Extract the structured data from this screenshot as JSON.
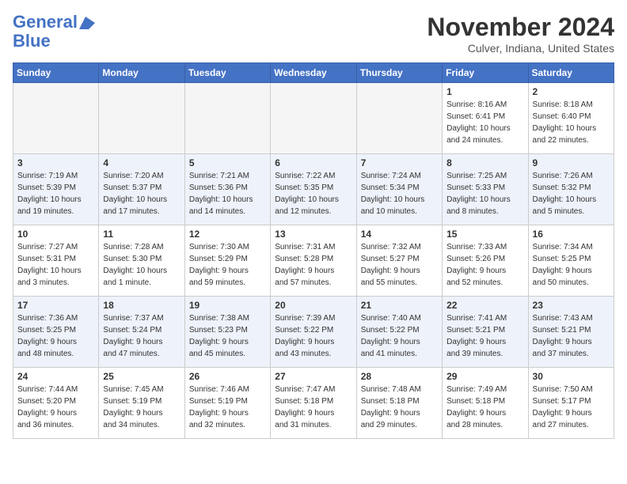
{
  "logo": {
    "line1": "General",
    "line2": "Blue"
  },
  "header": {
    "month": "November 2024",
    "location": "Culver, Indiana, United States"
  },
  "weekdays": [
    "Sunday",
    "Monday",
    "Tuesday",
    "Wednesday",
    "Thursday",
    "Friday",
    "Saturday"
  ],
  "weeks": [
    [
      {
        "day": "",
        "info": ""
      },
      {
        "day": "",
        "info": ""
      },
      {
        "day": "",
        "info": ""
      },
      {
        "day": "",
        "info": ""
      },
      {
        "day": "",
        "info": ""
      },
      {
        "day": "1",
        "info": "Sunrise: 8:16 AM\nSunset: 6:41 PM\nDaylight: 10 hours\nand 24 minutes."
      },
      {
        "day": "2",
        "info": "Sunrise: 8:18 AM\nSunset: 6:40 PM\nDaylight: 10 hours\nand 22 minutes."
      }
    ],
    [
      {
        "day": "3",
        "info": "Sunrise: 7:19 AM\nSunset: 5:39 PM\nDaylight: 10 hours\nand 19 minutes."
      },
      {
        "day": "4",
        "info": "Sunrise: 7:20 AM\nSunset: 5:37 PM\nDaylight: 10 hours\nand 17 minutes."
      },
      {
        "day": "5",
        "info": "Sunrise: 7:21 AM\nSunset: 5:36 PM\nDaylight: 10 hours\nand 14 minutes."
      },
      {
        "day": "6",
        "info": "Sunrise: 7:22 AM\nSunset: 5:35 PM\nDaylight: 10 hours\nand 12 minutes."
      },
      {
        "day": "7",
        "info": "Sunrise: 7:24 AM\nSunset: 5:34 PM\nDaylight: 10 hours\nand 10 minutes."
      },
      {
        "day": "8",
        "info": "Sunrise: 7:25 AM\nSunset: 5:33 PM\nDaylight: 10 hours\nand 8 minutes."
      },
      {
        "day": "9",
        "info": "Sunrise: 7:26 AM\nSunset: 5:32 PM\nDaylight: 10 hours\nand 5 minutes."
      }
    ],
    [
      {
        "day": "10",
        "info": "Sunrise: 7:27 AM\nSunset: 5:31 PM\nDaylight: 10 hours\nand 3 minutes."
      },
      {
        "day": "11",
        "info": "Sunrise: 7:28 AM\nSunset: 5:30 PM\nDaylight: 10 hours\nand 1 minute."
      },
      {
        "day": "12",
        "info": "Sunrise: 7:30 AM\nSunset: 5:29 PM\nDaylight: 9 hours\nand 59 minutes."
      },
      {
        "day": "13",
        "info": "Sunrise: 7:31 AM\nSunset: 5:28 PM\nDaylight: 9 hours\nand 57 minutes."
      },
      {
        "day": "14",
        "info": "Sunrise: 7:32 AM\nSunset: 5:27 PM\nDaylight: 9 hours\nand 55 minutes."
      },
      {
        "day": "15",
        "info": "Sunrise: 7:33 AM\nSunset: 5:26 PM\nDaylight: 9 hours\nand 52 minutes."
      },
      {
        "day": "16",
        "info": "Sunrise: 7:34 AM\nSunset: 5:25 PM\nDaylight: 9 hours\nand 50 minutes."
      }
    ],
    [
      {
        "day": "17",
        "info": "Sunrise: 7:36 AM\nSunset: 5:25 PM\nDaylight: 9 hours\nand 48 minutes."
      },
      {
        "day": "18",
        "info": "Sunrise: 7:37 AM\nSunset: 5:24 PM\nDaylight: 9 hours\nand 47 minutes."
      },
      {
        "day": "19",
        "info": "Sunrise: 7:38 AM\nSunset: 5:23 PM\nDaylight: 9 hours\nand 45 minutes."
      },
      {
        "day": "20",
        "info": "Sunrise: 7:39 AM\nSunset: 5:22 PM\nDaylight: 9 hours\nand 43 minutes."
      },
      {
        "day": "21",
        "info": "Sunrise: 7:40 AM\nSunset: 5:22 PM\nDaylight: 9 hours\nand 41 minutes."
      },
      {
        "day": "22",
        "info": "Sunrise: 7:41 AM\nSunset: 5:21 PM\nDaylight: 9 hours\nand 39 minutes."
      },
      {
        "day": "23",
        "info": "Sunrise: 7:43 AM\nSunset: 5:21 PM\nDaylight: 9 hours\nand 37 minutes."
      }
    ],
    [
      {
        "day": "24",
        "info": "Sunrise: 7:44 AM\nSunset: 5:20 PM\nDaylight: 9 hours\nand 36 minutes."
      },
      {
        "day": "25",
        "info": "Sunrise: 7:45 AM\nSunset: 5:19 PM\nDaylight: 9 hours\nand 34 minutes."
      },
      {
        "day": "26",
        "info": "Sunrise: 7:46 AM\nSunset: 5:19 PM\nDaylight: 9 hours\nand 32 minutes."
      },
      {
        "day": "27",
        "info": "Sunrise: 7:47 AM\nSunset: 5:18 PM\nDaylight: 9 hours\nand 31 minutes."
      },
      {
        "day": "28",
        "info": "Sunrise: 7:48 AM\nSunset: 5:18 PM\nDaylight: 9 hours\nand 29 minutes."
      },
      {
        "day": "29",
        "info": "Sunrise: 7:49 AM\nSunset: 5:18 PM\nDaylight: 9 hours\nand 28 minutes."
      },
      {
        "day": "30",
        "info": "Sunrise: 7:50 AM\nSunset: 5:17 PM\nDaylight: 9 hours\nand 27 minutes."
      }
    ]
  ]
}
